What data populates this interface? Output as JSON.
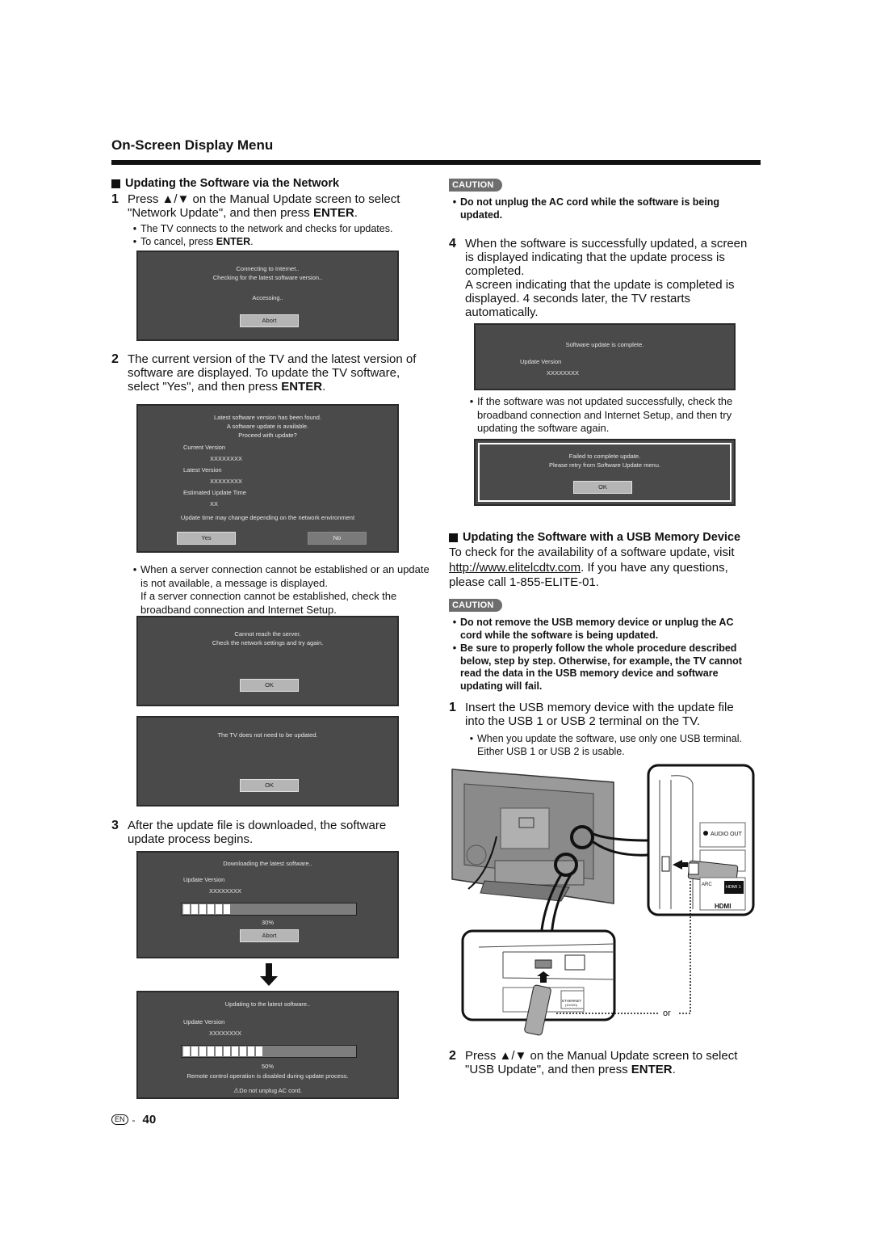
{
  "header": {
    "title": "On-Screen Display Menu"
  },
  "network": {
    "heading": "Updating the Software via the Network",
    "step1": {
      "num": "1",
      "pre": "Press",
      "arrows": "▲/▼",
      "post": " on the Manual Update screen to select \"Network Update\", and then press ",
      "enter": "ENTER",
      "end": ".",
      "bullets": [
        "The TV connects to the network and checks for updates.",
        "To cancel, press "
      ],
      "bullet2_bold": "ENTER",
      "bullet2_end": "."
    },
    "screen_connecting": {
      "line1": "Connecting to Internet..",
      "line2": "Checking for the latest software version..",
      "line3": "Accessing..",
      "button": "Abort"
    },
    "step2": {
      "num": "2",
      "text": "The current version of the TV and the latest version of software are displayed. To update the TV software, select \"Yes\", and then press ",
      "enter": "ENTER",
      "end": "."
    },
    "screen_found": {
      "line1": "Latest software version has been found.",
      "line2": "A software update is available.",
      "line3": "Proceed with update?",
      "current_label": "Current Version",
      "current_value": "XXXXXXXX",
      "latest_label": "Latest Version",
      "latest_value": "XXXXXXXX",
      "time_label": "Estimated Update Time",
      "time_value": "XX",
      "note": "Update time may change depending on the network environment",
      "yes": "Yes",
      "no": "No"
    },
    "server_note": {
      "line1": "When a server connection cannot be established or an update is not available, a message is displayed.",
      "line2": "If a server connection cannot be established, check the broadband connection and Internet Setup."
    },
    "screen_noserver": {
      "line1": "Cannot reach the server.",
      "line2": "Check the network settings and try again.",
      "button": "OK"
    },
    "screen_noupdate": {
      "line1": "The TV does not need to be updated.",
      "button": "OK"
    },
    "step3": {
      "num": "3",
      "text": "After the update file is downloaded, the software update process begins."
    },
    "screen_download": {
      "line1": "Downloading the latest software..",
      "version_label": "Update Version",
      "version_value": "XXXXXXXX",
      "progress_percent": 30,
      "progress_text": "30%",
      "button": "Abort"
    },
    "arrow_icon": "down-arrow",
    "screen_updating": {
      "line1": "Updating to the latest software..",
      "version_label": "Update Version",
      "version_value": "XXXXXXXX",
      "progress_percent": 50,
      "progress_text": "50%",
      "note": "Remote control operation is disabled during update process.",
      "warning": "Do not unplug AC cord."
    }
  },
  "right": {
    "caution1": {
      "label": "CAUTION",
      "bullet": "Do not unplug the AC cord while the software is being updated."
    },
    "step4": {
      "num": "4",
      "text1": "When the software is successfully updated, a screen is displayed indicating that the update process is completed.",
      "text2": "A screen indicating that the update is completed is displayed. 4 seconds later, the TV restarts automatically."
    },
    "screen_complete": {
      "line1": "Software update is complete.",
      "version_label": "Update Version",
      "version_value": "XXXXXXXX"
    },
    "fail_note": "If the software was not updated successfully, check the broadband connection and Internet Setup, and then try updating the software again.",
    "screen_failed": {
      "line1": "Failed to complete update.",
      "line2": "Please retry from Software Update menu.",
      "button": "OK"
    },
    "usb": {
      "heading": "Updating the Software with a USB Memory Device",
      "intro_pre": "To check for the availability of a software update, visit ",
      "link": "http://www.elitelcdtv.com",
      "intro_post": ". If you have any questions, please call 1-855-ELITE-01.",
      "caution_label": "CAUTION",
      "caution_bullets": [
        "Do not remove the USB memory device or unplug the AC cord while the software is being updated.",
        "Be sure to properly follow the whole procedure described below, step by step. Otherwise, for example, the TV cannot read the data in the USB memory device and software updating will fail."
      ],
      "step1": {
        "num": "1",
        "text": "Insert the USB memory device with the update file into the USB 1 or USB 2 terminal on the TV.",
        "bullet": "When you update the software, use only one USB terminal. Either USB 1 or USB 2 is usable."
      },
      "illustration": {
        "audio_out": "AUDIO OUT",
        "arc": "ARC",
        "hdmi1": "HDMI 1",
        "hdmi_logo": "HDMI",
        "ethernet": "ETHERNET",
        "ethernet_sub": "(10/100)",
        "or": "or"
      },
      "step2": {
        "num": "2",
        "pre": "Press ",
        "arrows": "▲/▼",
        "post": " on the Manual Update screen to select \"USB Update\", and then press ",
        "enter": "ENTER",
        "end": "."
      }
    }
  },
  "footer": {
    "lang": "EN",
    "sep": "-",
    "page": "40"
  }
}
